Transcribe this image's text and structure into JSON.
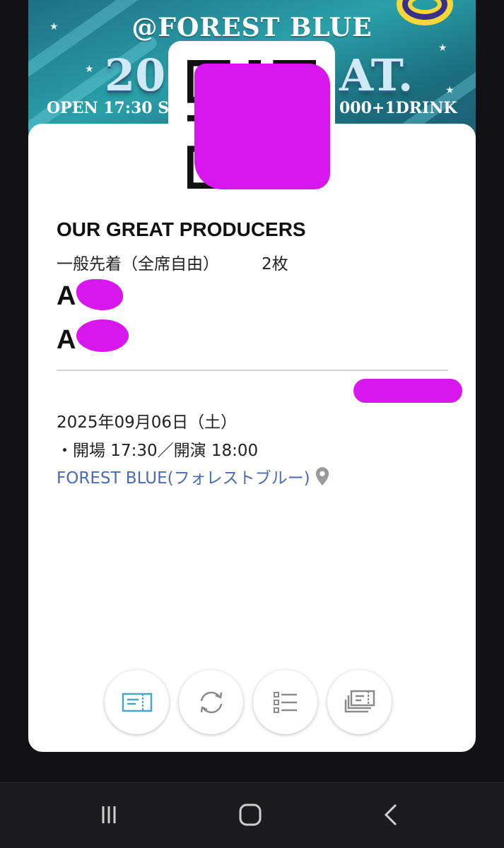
{
  "banner": {
    "venue": "@FOREST BLUE",
    "big_left": "202",
    "big_right": "AT.",
    "bottom_left": "OPEN 17:30  STA",
    "bottom_right": "000+1DRINK"
  },
  "ticket": {
    "event_title": "OUR GREAT PRODUCERS",
    "ticket_type": "一般先着（全席自由）",
    "count": "2枚",
    "seats": [
      "A",
      "A"
    ],
    "date": "2025年09月06日（土）",
    "times": "・開場 17:30／開演 18:00",
    "venue_link": "FOREST BLUE(フォレストブルー)"
  },
  "actions": [
    {
      "name": "ticket-view",
      "icon": "ticket-icon",
      "active": true
    },
    {
      "name": "refresh",
      "icon": "refresh-icon",
      "active": false
    },
    {
      "name": "list",
      "icon": "checklist-icon",
      "active": false
    },
    {
      "name": "tickets",
      "icon": "tickets-stack-icon",
      "active": false
    }
  ],
  "colors": {
    "accent": "#4a6bb5",
    "redaction": "#d816ee",
    "active_icon": "#4aa3c9",
    "inactive_icon": "#8a8a8a"
  },
  "navbar": {
    "buttons": [
      "recents-icon",
      "home-icon",
      "back-icon"
    ]
  }
}
